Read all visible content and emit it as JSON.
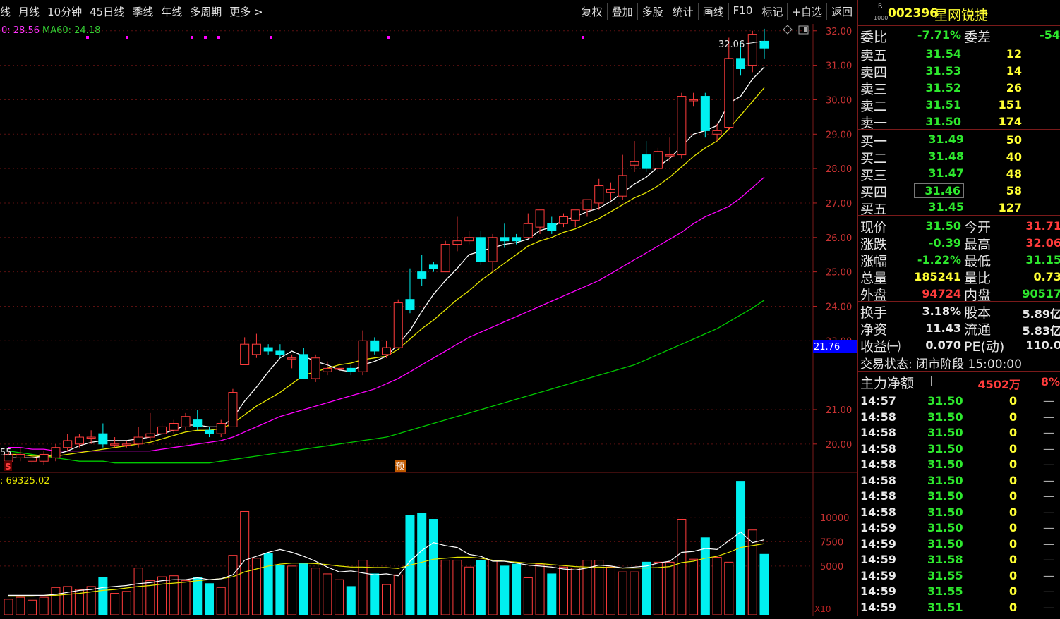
{
  "toolbar": {
    "periods": [
      "线",
      "月线",
      "10分钟",
      "45日线",
      "季线",
      "年线",
      "多周期",
      "更多 >"
    ],
    "actions": [
      "复权",
      "叠加",
      "多股",
      "统计",
      "画线",
      "F10",
      "标记",
      "+自选",
      "返回"
    ]
  },
  "chart_header": {
    "ma_text_a": "0: 28.56",
    "ma_text_b": "MA60: 24.18",
    "high_label": "32.06",
    "low_label": "55",
    "marker_s": "S",
    "marker_yu": "预",
    "vol_label": ": 69325.02",
    "current_price_tag": "21.76",
    "vol_scale_label": "X10"
  },
  "chart_data": {
    "type": "candlestick",
    "price_axis": {
      "ticks": [
        32,
        31,
        30,
        29,
        28,
        27,
        26,
        25,
        24,
        23,
        21,
        20
      ],
      "tick_labels": [
        "32.00",
        "31.00",
        "30.00",
        "29.00",
        "28.00",
        "27.00",
        "26.00",
        "25.00",
        "24.00",
        "23.00",
        "21.00",
        "20.00"
      ],
      "range": [
        19.3,
        32.2
      ]
    },
    "volume_axis": {
      "ticks": [
        10000,
        7500,
        5000
      ],
      "tick_labels": [
        "10000",
        "7500",
        "5000"
      ],
      "range": [
        0,
        13600
      ]
    },
    "candles": [
      [
        19.5,
        19.7,
        19.4,
        19.8
      ],
      [
        19.6,
        19.7,
        19.5,
        19.9
      ],
      [
        19.5,
        19.6,
        19.4,
        19.7
      ],
      [
        19.5,
        19.7,
        19.4,
        19.8
      ],
      [
        19.6,
        19.9,
        19.5,
        20.0
      ],
      [
        19.9,
        20.1,
        19.8,
        20.3
      ],
      [
        20.0,
        20.2,
        19.9,
        20.3
      ],
      [
        20.2,
        20.2,
        20.0,
        20.4
      ],
      [
        20.3,
        20.0,
        19.9,
        20.6
      ],
      [
        20.0,
        20.0,
        19.9,
        20.2
      ],
      [
        20.0,
        20.0,
        19.9,
        20.1
      ],
      [
        20.0,
        20.2,
        19.9,
        20.5
      ],
      [
        20.2,
        20.3,
        20.1,
        20.9
      ],
      [
        20.3,
        20.5,
        20.2,
        20.6
      ],
      [
        20.4,
        20.6,
        20.3,
        20.7
      ],
      [
        20.5,
        20.8,
        20.4,
        20.9
      ],
      [
        20.7,
        20.5,
        20.4,
        21.0
      ],
      [
        20.4,
        20.3,
        20.2,
        20.5
      ],
      [
        20.3,
        20.6,
        20.2,
        20.7
      ],
      [
        20.5,
        21.5,
        20.5,
        21.6
      ],
      [
        22.3,
        22.9,
        22.3,
        23.1
      ],
      [
        22.6,
        22.9,
        22.5,
        23.2
      ],
      [
        22.8,
        22.7,
        22.6,
        22.9
      ],
      [
        22.7,
        22.6,
        22.5,
        22.9
      ],
      [
        22.5,
        22.5,
        22.2,
        22.6
      ],
      [
        22.6,
        21.9,
        21.9,
        22.8
      ],
      [
        21.9,
        22.5,
        21.8,
        22.6
      ],
      [
        22.1,
        22.2,
        22.0,
        22.4
      ],
      [
        22.2,
        22.2,
        22.1,
        22.4
      ],
      [
        22.2,
        22.1,
        22.0,
        22.3
      ],
      [
        22.1,
        23.0,
        22.0,
        23.3
      ],
      [
        23.0,
        22.7,
        22.6,
        23.1
      ],
      [
        22.6,
        22.8,
        22.5,
        23.0
      ],
      [
        22.8,
        24.1,
        22.8,
        24.2
      ],
      [
        24.2,
        23.9,
        23.8,
        25.1
      ],
      [
        25.0,
        24.8,
        24.6,
        25.5
      ],
      [
        25.2,
        25.1,
        25.0,
        25.3
      ],
      [
        25.0,
        25.8,
        25.0,
        25.9
      ],
      [
        25.8,
        25.9,
        25.6,
        26.6
      ],
      [
        25.9,
        26.0,
        25.8,
        26.2
      ],
      [
        26.0,
        25.3,
        25.2,
        26.2
      ],
      [
        25.3,
        26.0,
        25.0,
        26.1
      ],
      [
        26.0,
        25.9,
        25.7,
        26.4
      ],
      [
        26.0,
        25.9,
        25.8,
        26.1
      ],
      [
        26.0,
        26.4,
        26.0,
        26.7
      ],
      [
        26.3,
        26.8,
        26.1,
        26.8
      ],
      [
        26.4,
        26.2,
        26.1,
        26.6
      ],
      [
        26.4,
        26.6,
        26.3,
        26.7
      ],
      [
        26.5,
        26.8,
        26.3,
        26.8
      ],
      [
        26.8,
        27.1,
        26.6,
        27.1
      ],
      [
        27.0,
        27.5,
        26.8,
        27.7
      ],
      [
        27.3,
        27.4,
        27.1,
        27.6
      ],
      [
        27.2,
        27.8,
        27.1,
        28.4
      ],
      [
        28.1,
        28.2,
        27.9,
        28.8
      ],
      [
        28.4,
        28.0,
        27.9,
        28.8
      ],
      [
        28.0,
        28.5,
        27.9,
        28.6
      ],
      [
        28.4,
        28.4,
        28.2,
        28.9
      ],
      [
        28.4,
        30.1,
        28.3,
        30.2
      ],
      [
        30.0,
        30.0,
        29.8,
        30.2
      ],
      [
        30.1,
        29.1,
        28.9,
        30.2
      ],
      [
        29.0,
        29.1,
        28.8,
        29.3
      ],
      [
        29.2,
        31.2,
        29.1,
        31.8
      ],
      [
        31.2,
        30.9,
        30.7,
        31.7
      ],
      [
        31.0,
        31.9,
        30.8,
        32.0
      ],
      [
        31.7,
        31.5,
        31.2,
        32.06
      ]
    ],
    "ma5": [
      19.6,
      19.6,
      19.6,
      19.65,
      19.7,
      19.8,
      19.95,
      20.05,
      20.1,
      20.1,
      20.1,
      20.15,
      20.2,
      20.3,
      20.4,
      20.55,
      20.55,
      20.5,
      20.5,
      20.75,
      21.25,
      21.65,
      22.1,
      22.5,
      22.7,
      22.55,
      22.4,
      22.3,
      22.15,
      22.1,
      22.3,
      22.4,
      22.55,
      22.9,
      23.3,
      23.85,
      24.35,
      24.75,
      25.1,
      25.5,
      25.6,
      25.7,
      25.8,
      25.85,
      25.95,
      26.2,
      26.3,
      26.5,
      26.6,
      26.75,
      26.85,
      27.05,
      27.3,
      27.55,
      27.75,
      28.05,
      28.3,
      28.65,
      29.0,
      29.1,
      29.25,
      29.9,
      30.1,
      30.6,
      30.95
    ],
    "ma10": [
      19.7,
      19.7,
      19.65,
      19.65,
      19.65,
      19.7,
      19.75,
      19.8,
      19.85,
      19.9,
      19.95,
      20.0,
      20.05,
      20.15,
      20.25,
      20.35,
      20.4,
      20.4,
      20.45,
      20.6,
      20.85,
      21.1,
      21.3,
      21.5,
      21.75,
      22.0,
      22.1,
      22.2,
      22.3,
      22.35,
      22.45,
      22.5,
      22.55,
      22.75,
      23.05,
      23.35,
      23.6,
      23.9,
      24.2,
      24.45,
      24.75,
      25.0,
      25.25,
      25.5,
      25.75,
      25.9,
      26.0,
      26.15,
      26.25,
      26.4,
      26.55,
      26.75,
      26.95,
      27.15,
      27.3,
      27.5,
      27.75,
      28.05,
      28.35,
      28.6,
      28.8,
      29.15,
      29.55,
      29.95,
      30.35
    ],
    "ma30": [
      19.9,
      19.9,
      19.85,
      19.85,
      19.8,
      19.8,
      19.8,
      19.8,
      19.8,
      19.8,
      19.8,
      19.8,
      19.8,
      19.85,
      19.9,
      19.95,
      20.0,
      20.05,
      20.1,
      20.2,
      20.35,
      20.5,
      20.65,
      20.8,
      20.9,
      21.0,
      21.1,
      21.2,
      21.3,
      21.4,
      21.5,
      21.6,
      21.75,
      21.9,
      22.1,
      22.3,
      22.5,
      22.7,
      22.9,
      23.1,
      23.25,
      23.4,
      23.55,
      23.7,
      23.85,
      24.0,
      24.15,
      24.3,
      24.45,
      24.6,
      24.75,
      24.95,
      25.15,
      25.35,
      25.55,
      25.75,
      25.95,
      26.15,
      26.4,
      26.6,
      26.75,
      26.9,
      27.15,
      27.45,
      27.75
    ],
    "ma60": [
      19.8,
      19.75,
      19.7,
      19.65,
      19.6,
      19.55,
      19.5,
      19.5,
      19.5,
      19.45,
      19.45,
      19.45,
      19.45,
      19.45,
      19.45,
      19.45,
      19.45,
      19.45,
      19.5,
      19.55,
      19.6,
      19.65,
      19.7,
      19.75,
      19.8,
      19.85,
      19.9,
      19.95,
      20.0,
      20.05,
      20.1,
      20.15,
      20.2,
      20.3,
      20.4,
      20.5,
      20.6,
      20.7,
      20.8,
      20.9,
      21.0,
      21.1,
      21.2,
      21.3,
      21.4,
      21.5,
      21.6,
      21.7,
      21.8,
      21.9,
      22.0,
      22.1,
      22.2,
      22.3,
      22.45,
      22.6,
      22.75,
      22.9,
      23.05,
      23.2,
      23.35,
      23.55,
      23.75,
      23.95,
      24.18
    ],
    "volumes": [
      1600,
      1800,
      1500,
      1800,
      2800,
      2900,
      2600,
      2900,
      3800,
      2200,
      2400,
      4800,
      3500,
      3900,
      4000,
      3500,
      3800,
      3200,
      2800,
      6100,
      10600,
      5800,
      6300,
      5100,
      5000,
      5300,
      4800,
      4200,
      3600,
      2900,
      5600,
      4200,
      3100,
      4100,
      10200,
      10400,
      9800,
      5600,
      5600,
      4900,
      5600,
      5600,
      5000,
      5200,
      3800,
      5200,
      4200,
      4900,
      4800,
      5600,
      5600,
      4900,
      4400,
      4400,
      5400,
      5400,
      5400,
      9800,
      5700,
      7900,
      5900,
      5400,
      13700,
      8700,
      6200
    ],
    "vol_ma_white": [
      2000,
      2000,
      2000,
      2000,
      2100,
      2300,
      2500,
      2600,
      2800,
      2900,
      3000,
      3200,
      3300,
      3500,
      3600,
      3600,
      3800,
      3600,
      3700,
      4100,
      5600,
      6000,
      6400,
      6700,
      6400,
      6000,
      5500,
      4900,
      4400,
      4500,
      4300,
      4100,
      4200,
      4000,
      5500,
      6600,
      7400,
      7100,
      6900,
      6200,
      6000,
      5500,
      5500,
      5300,
      5100,
      5000,
      4900,
      4700,
      4600,
      4800,
      5100,
      5000,
      4800,
      4900,
      5000,
      5300,
      5500,
      6400,
      6500,
      6800,
      6700,
      7600,
      8500,
      7400,
      7700
    ],
    "vol_ma_yellow": [
      1900,
      1900,
      1900,
      1950,
      2000,
      2100,
      2200,
      2350,
      2500,
      2600,
      2750,
      2900,
      3000,
      3150,
      3250,
      3350,
      3500,
      3600,
      3700,
      3900,
      4400,
      4700,
      5000,
      5200,
      5300,
      5300,
      5250,
      5150,
      5000,
      4900,
      4900,
      4850,
      4850,
      4750,
      5100,
      5400,
      5700,
      5800,
      5900,
      5900,
      5800,
      5600,
      5500,
      5400,
      5300,
      5250,
      5150,
      5050,
      4950,
      4900,
      4900,
      4850,
      4800,
      4800,
      4800,
      4850,
      4950,
      5350,
      5500,
      5800,
      6000,
      6400,
      6900,
      7100,
      7300
    ],
    "purple_marks": [
      122,
      178,
      270,
      289,
      308,
      382,
      548,
      824
    ],
    "series": [
      {
        "name": "MA60",
        "value": 24.18
      }
    ]
  },
  "panel": {
    "stock_code": "002396",
    "stock_name": "星网锐捷",
    "badge_top": "R",
    "badge_bottom": "1000",
    "weibi_label": "委比",
    "weibi_value": "-7.71%",
    "weicha_label": "委差",
    "weicha_value": "-54",
    "asks": [
      {
        "label": "卖五",
        "price": "31.54",
        "vol": "12"
      },
      {
        "label": "卖四",
        "price": "31.53",
        "vol": "14"
      },
      {
        "label": "卖三",
        "price": "31.52",
        "vol": "26"
      },
      {
        "label": "卖二",
        "price": "31.51",
        "vol": "151"
      },
      {
        "label": "卖一",
        "price": "31.50",
        "vol": "174"
      }
    ],
    "bids": [
      {
        "label": "买一",
        "price": "31.49",
        "vol": "50"
      },
      {
        "label": "买二",
        "price": "31.48",
        "vol": "40"
      },
      {
        "label": "买三",
        "price": "31.47",
        "vol": "48"
      },
      {
        "label": "买四",
        "price": "31.46",
        "vol": "58"
      },
      {
        "label": "买五",
        "price": "31.45",
        "vol": "127"
      }
    ],
    "stats": [
      {
        "l1": "现价",
        "v1": "31.50",
        "c1": "g",
        "l2": "今开",
        "v2": "31.71",
        "c2": "r"
      },
      {
        "l1": "涨跌",
        "v1": "-0.39",
        "c1": "g",
        "l2": "最高",
        "v2": "32.06",
        "c2": "r"
      },
      {
        "l1": "涨幅",
        "v1": "-1.22%",
        "c1": "g",
        "l2": "最低",
        "v2": "31.15",
        "c2": "g"
      },
      {
        "l1": "总量",
        "v1": "185241",
        "c1": "y",
        "l2": "量比",
        "v2": "0.73",
        "c2": "y"
      },
      {
        "l1": "外盘",
        "v1": "94724",
        "c1": "r",
        "l2": "内盘",
        "v2": "90517",
        "c2": "g"
      }
    ],
    "stats2": [
      {
        "l1": "换手",
        "v1": "3.18%",
        "l2": "股本",
        "v2": "5.89亿"
      },
      {
        "l1": "净资",
        "v1": "11.43",
        "l2": "流通",
        "v2": "5.83亿"
      },
      {
        "l1": "收益㈠",
        "v1": "0.070",
        "l2": "PE(动)",
        "v2": "110.0"
      }
    ],
    "trade_status": "交易状态: 闭市阶段 15:00:00",
    "main_flow_label": "主力净额",
    "main_flow_value": "4502万",
    "main_flow_pct": "8%",
    "ticks": [
      {
        "t": "14:57",
        "p": "31.50",
        "v": "0",
        "d": "—"
      },
      {
        "t": "14:58",
        "p": "31.50",
        "v": "0",
        "d": "—"
      },
      {
        "t": "14:58",
        "p": "31.50",
        "v": "0",
        "d": "—"
      },
      {
        "t": "14:58",
        "p": "31.50",
        "v": "0",
        "d": "—"
      },
      {
        "t": "14:58",
        "p": "31.50",
        "v": "0",
        "d": "—"
      },
      {
        "t": "14:58",
        "p": "31.50",
        "v": "0",
        "d": "—"
      },
      {
        "t": "14:58",
        "p": "31.50",
        "v": "0",
        "d": "—"
      },
      {
        "t": "14:58",
        "p": "31.50",
        "v": "0",
        "d": "—"
      },
      {
        "t": "14:59",
        "p": "31.50",
        "v": "0",
        "d": "—"
      },
      {
        "t": "14:59",
        "p": "31.50",
        "v": "0",
        "d": "—"
      },
      {
        "t": "14:59",
        "p": "31.58",
        "v": "0",
        "d": "—"
      },
      {
        "t": "14:59",
        "p": "31.55",
        "v": "0",
        "d": "—"
      },
      {
        "t": "14:59",
        "p": "31.55",
        "v": "0",
        "d": "—"
      },
      {
        "t": "14:59",
        "p": "31.51",
        "v": "0",
        "d": "—"
      }
    ]
  },
  "colors": {
    "up": "#ff3c3c",
    "down": "#00f0f0",
    "ma5": "#ffffff",
    "ma10": "#e6e600",
    "ma30": "#ff00ff",
    "ma60": "#00c800",
    "accent": "#7a1a1a"
  }
}
